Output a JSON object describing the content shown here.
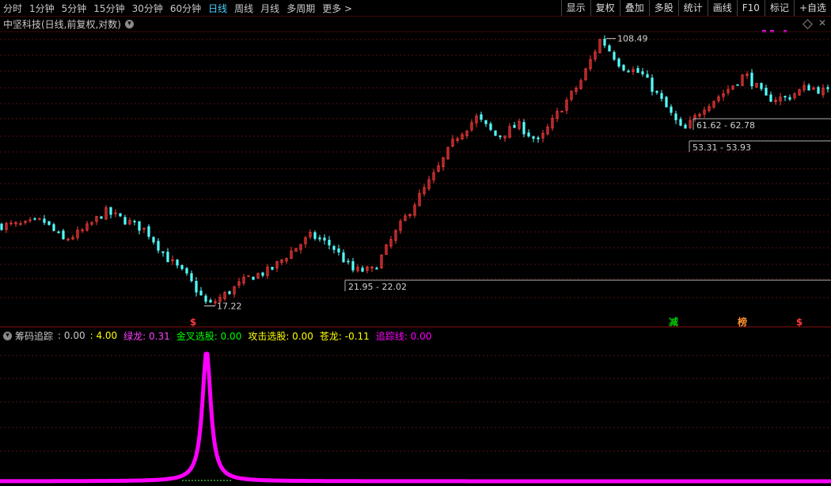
{
  "toolbar": {
    "periods": [
      "分时",
      "1分钟",
      "5分钟",
      "15分钟",
      "30分钟",
      "60分钟",
      "日线",
      "周线",
      "月线",
      "多周期",
      "更多 >"
    ],
    "active_period": "日线",
    "right_buttons": [
      "显示",
      "复权",
      "叠加",
      "多股",
      "统计",
      "画线",
      "F10",
      "标记",
      "+自选"
    ]
  },
  "chart_header": {
    "title": "中坚科技(日线,前复权,对数)"
  },
  "colors": {
    "up": "#ff3c3c",
    "down": "#54ffff",
    "grid": "#5a1010",
    "pink": "#ff00ff",
    "green_marker": "#00d000",
    "orange_marker": "#ff9030",
    "red_marker": "#ff3c3c"
  },
  "annotations": {
    "high": "108.49",
    "low": "17.22",
    "range1": "61.62 - 62.78",
    "range2": "53.31 - 53.93",
    "range3": "21.95 - 22.02"
  },
  "markers": [
    {
      "label": "$",
      "color": "red"
    },
    {
      "label": "减",
      "color": "green"
    },
    {
      "label": "榜",
      "color": "orange"
    },
    {
      "label": "$",
      "color": "red"
    }
  ],
  "indicator": {
    "name": "筹码追踪",
    "v1": ": 0.00",
    "v2": ": 4.00",
    "items": [
      {
        "label": "绿龙: 0.31",
        "color": "#ff40ff"
      },
      {
        "label": "金叉选股: 0.00",
        "color": "#00ff00"
      },
      {
        "label": "攻击选股: 0.00",
        "color": "#ffff00"
      },
      {
        "label": "苍龙: -0.11",
        "color": "#ffff00"
      },
      {
        "label": "追踪线: 0.00",
        "color": "#ff00ff"
      }
    ]
  },
  "chart_data": [
    {
      "type": "candlestick",
      "title": "中坚科技(日线,前复权,对数)",
      "scale": "log",
      "ylim": [
        16,
        115
      ],
      "anchor_prices": [
        30,
        30,
        31,
        27,
        29,
        33,
        31,
        29,
        24,
        21,
        17.2,
        19,
        21,
        22,
        25,
        28,
        26,
        22,
        22,
        28,
        35,
        43,
        55,
        63,
        55,
        60,
        53,
        66,
        80,
        108.49,
        90,
        85,
        70,
        57,
        68,
        75,
        85,
        72,
        72,
        78,
        75
      ],
      "labels": {
        "high": "108.49",
        "low": "17.22",
        "ranges": [
          "61.62 - 62.78",
          "53.31 - 53.93",
          "21.95 - 22.02"
        ]
      }
    },
    {
      "type": "line",
      "series": [
        {
          "name": "追踪线",
          "peak_value": 4.0
        }
      ],
      "values_note_peak_at_fraction": 0.25,
      "ylim": [
        0,
        4.2
      ]
    }
  ]
}
